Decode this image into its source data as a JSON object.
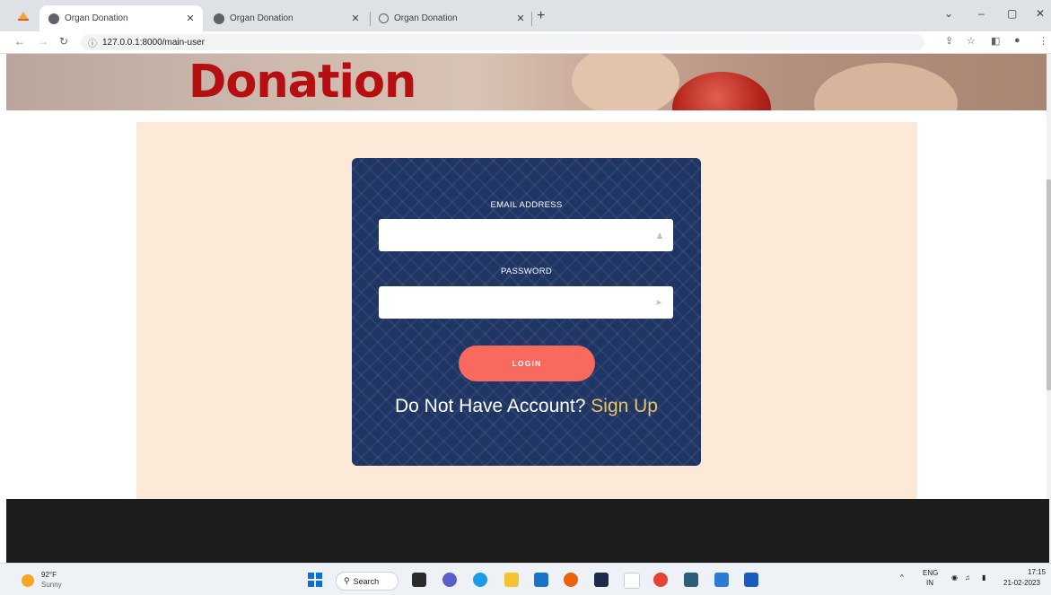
{
  "browser": {
    "tabs": [
      {
        "title": "Organ Donation",
        "active": true
      },
      {
        "title": "Organ Donation",
        "active": false
      },
      {
        "title": "Organ Donation",
        "active": false
      }
    ],
    "url": "127.0.0.1:8000/main-user"
  },
  "banner": {
    "title": "Donation"
  },
  "login": {
    "email_label": "EMAIL ADDRESS",
    "email_value": "",
    "password_label": "PASSWORD",
    "password_value": "",
    "button_label": "LOGIN",
    "signup_prompt": "Do Not Have Account?",
    "signup_link": "Sign Up"
  },
  "taskbar": {
    "weather_temp": "92°F",
    "weather_desc": "Sunny",
    "search_label": "Search",
    "language": "ENG",
    "region": "IN",
    "time": "17:15",
    "date": "21-02-2023"
  },
  "colors": {
    "banner_title": "#b50f12",
    "card_bg": "#1f3564",
    "login_button": "#f96a5e",
    "signup_link": "#e8c36a",
    "page_bg": "#fce9d7"
  }
}
